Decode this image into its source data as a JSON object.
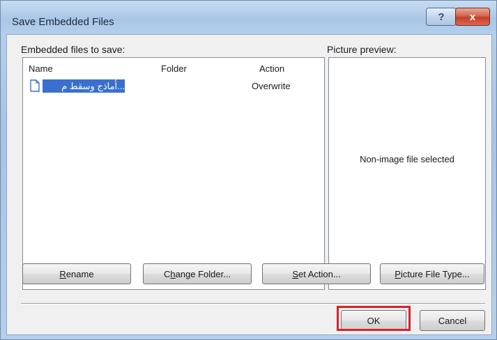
{
  "window": {
    "title": "Save Embedded Files"
  },
  "titlebar_buttons": {
    "help_label": "?",
    "close_label": "x"
  },
  "labels": {
    "embedded_files": "Embedded files to save:",
    "picture_preview": "Picture preview:"
  },
  "table": {
    "columns": [
      "Name",
      "Folder",
      "Action"
    ],
    "rows": [
      {
        "name": "...ﺃﻣﺎﺫﺝ ﻭﺳﻘﻂ ﻡ",
        "folder": "",
        "action": "Overwrite",
        "selected": true
      }
    ]
  },
  "preview": {
    "status_text": "Non-image file selected"
  },
  "buttons": {
    "rename": {
      "mnemonic": "R",
      "rest": "ename"
    },
    "change_folder": {
      "prefix": "C",
      "mnemonic": "h",
      "rest": "ange Folder..."
    },
    "set_action": {
      "mnemonic": "S",
      "rest": "et Action..."
    },
    "picture_file_type": {
      "mnemonic": "P",
      "rest": "icture File Type..."
    },
    "ok": "OK",
    "cancel": "Cancel"
  },
  "colors": {
    "selection": "#3a6fd0",
    "highlight_box": "#d8232a"
  },
  "icons": {
    "file": "document-icon",
    "help": "help-icon",
    "close": "close-icon"
  }
}
